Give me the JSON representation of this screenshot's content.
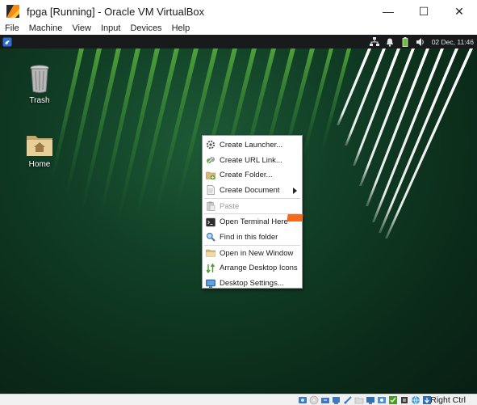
{
  "window": {
    "title": "fpga [Running] - Oracle VM VirtualBox",
    "controls": {
      "minimize": "—",
      "maximize": "☐",
      "close": "✕"
    }
  },
  "menubar": [
    "File",
    "Machine",
    "View",
    "Input",
    "Devices",
    "Help"
  ],
  "panel": {
    "clock": "02 Dec, 11:46"
  },
  "desktop_icons": [
    {
      "label": "Trash",
      "icon": "trash-icon"
    },
    {
      "label": "Home",
      "icon": "home-folder-icon"
    }
  ],
  "context_menu": {
    "items": [
      {
        "label": "Create Launcher...",
        "icon": "gear-icon"
      },
      {
        "label": "Create URL Link...",
        "icon": "link-icon"
      },
      {
        "label": "Create Folder...",
        "icon": "folder-add-icon"
      },
      {
        "label": "Create Document",
        "icon": "document-icon",
        "submenu": true
      },
      {
        "label": "Paste",
        "icon": "paste-icon",
        "disabled": true
      },
      {
        "label": "Open Terminal Here",
        "icon": "terminal-icon"
      },
      {
        "label": "Find in this folder",
        "icon": "magnifier-icon"
      },
      {
        "label": "Open in New Window",
        "icon": "folder-open-icon"
      },
      {
        "label": "Arrange Desktop Icons",
        "icon": "arrange-icon"
      },
      {
        "label": "Desktop Settings...",
        "icon": "monitor-icon"
      }
    ]
  },
  "statusbar": {
    "host_key": "Right Ctrl"
  },
  "colors": {
    "accent_orange": "#f26b1d",
    "wallpaper_green": "#113f26",
    "panel": "#181a1c"
  }
}
